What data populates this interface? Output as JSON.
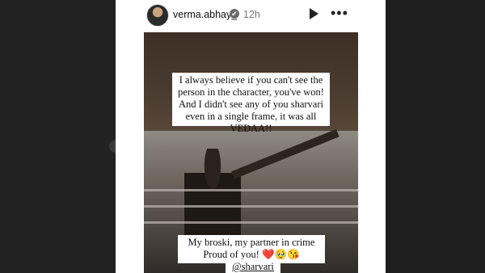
{
  "story": {
    "username": "verma.abhay_",
    "verified_icon": "✔",
    "time": "12h",
    "caption_1": "I always believe if you can't see the person in the character, you've won! And I didn't see any of you sharvari even in a single frame, it was all VEDAA!!",
    "caption_2_line1": "My broski, my partner in crime",
    "caption_2_line2": "Proud of you!",
    "caption_2_emojis": "❤️🥹😘",
    "mention": "@sharvari"
  },
  "icons": {
    "play": "play-icon",
    "more": "more-options-icon",
    "verified": "verified-badge-icon"
  },
  "colors": {
    "background": "#1f1f1f",
    "story_bg": "#ffffff",
    "heart": "#c8102e"
  }
}
